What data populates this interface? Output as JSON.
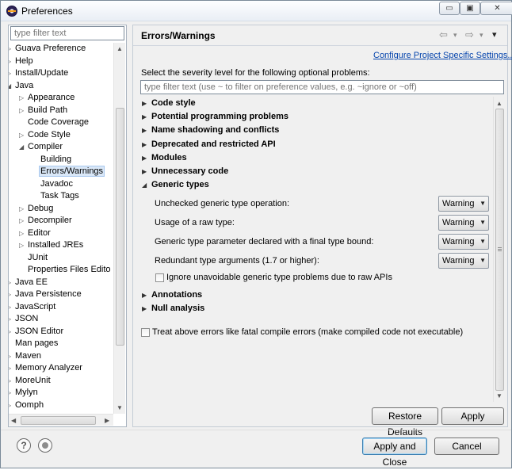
{
  "window": {
    "title": "Preferences",
    "minimize": "▭",
    "maximize": "▣",
    "close": "✕"
  },
  "left": {
    "filter_placeholder": "type filter text",
    "tree": [
      {
        "label": "Guava Preference",
        "level": 0,
        "twisty": "closed"
      },
      {
        "label": "Help",
        "level": 0,
        "twisty": "closed"
      },
      {
        "label": "Install/Update",
        "level": 0,
        "twisty": "closed"
      },
      {
        "label": "Java",
        "level": 0,
        "twisty": "open"
      },
      {
        "label": "Appearance",
        "level": 1,
        "twisty": "closed"
      },
      {
        "label": "Build Path",
        "level": 1,
        "twisty": "closed"
      },
      {
        "label": "Code Coverage",
        "level": 1,
        "twisty": "none"
      },
      {
        "label": "Code Style",
        "level": 1,
        "twisty": "closed"
      },
      {
        "label": "Compiler",
        "level": 1,
        "twisty": "open"
      },
      {
        "label": "Building",
        "level": 2,
        "twisty": "none"
      },
      {
        "label": "Errors/Warnings",
        "level": 2,
        "twisty": "none",
        "selected": true
      },
      {
        "label": "Javadoc",
        "level": 2,
        "twisty": "none"
      },
      {
        "label": "Task Tags",
        "level": 2,
        "twisty": "none"
      },
      {
        "label": "Debug",
        "level": 1,
        "twisty": "closed"
      },
      {
        "label": "Decompiler",
        "level": 1,
        "twisty": "closed"
      },
      {
        "label": "Editor",
        "level": 1,
        "twisty": "closed"
      },
      {
        "label": "Installed JREs",
        "level": 1,
        "twisty": "closed"
      },
      {
        "label": "JUnit",
        "level": 1,
        "twisty": "none"
      },
      {
        "label": "Properties Files Edito",
        "level": 1,
        "twisty": "none"
      },
      {
        "label": "Java EE",
        "level": 0,
        "twisty": "closed"
      },
      {
        "label": "Java Persistence",
        "level": 0,
        "twisty": "closed"
      },
      {
        "label": "JavaScript",
        "level": 0,
        "twisty": "closed"
      },
      {
        "label": "JSON",
        "level": 0,
        "twisty": "closed"
      },
      {
        "label": "JSON Editor",
        "level": 0,
        "twisty": "closed"
      },
      {
        "label": "Man pages",
        "level": 0,
        "twisty": "none"
      },
      {
        "label": "Maven",
        "level": 0,
        "twisty": "closed"
      },
      {
        "label": "Memory Analyzer",
        "level": 0,
        "twisty": "closed"
      },
      {
        "label": "MoreUnit",
        "level": 0,
        "twisty": "closed"
      },
      {
        "label": "Mylyn",
        "level": 0,
        "twisty": "closed"
      },
      {
        "label": "Oomph",
        "level": 0,
        "twisty": "closed"
      }
    ]
  },
  "right": {
    "title": "Errors/Warnings",
    "nav_back": "⇦",
    "nav_forward": "⇨",
    "nav_menu": "▾",
    "config_link": "Configure Project Specific Settings...",
    "description": "Select the severity level for the following optional problems:",
    "filter_placeholder": "type filter text (use ~ to filter on preference values, e.g. ~ignore or ~off)",
    "sections": [
      {
        "label": "Code style",
        "expanded": false
      },
      {
        "label": "Potential programming problems",
        "expanded": false
      },
      {
        "label": "Name shadowing and conflicts",
        "expanded": false
      },
      {
        "label": "Deprecated and restricted API",
        "expanded": false
      },
      {
        "label": "Modules",
        "expanded": false
      },
      {
        "label": "Unnecessary code",
        "expanded": false
      },
      {
        "label": "Generic types",
        "expanded": true
      },
      {
        "label": "Annotations",
        "expanded": false
      },
      {
        "label": "Null analysis",
        "expanded": false
      }
    ],
    "generic_options": [
      {
        "label": "Unchecked generic type operation:",
        "value": "Warning"
      },
      {
        "label": "Usage of a raw type:",
        "value": "Warning"
      },
      {
        "label": "Generic type parameter declared with a final type bound:",
        "value": "Warning"
      },
      {
        "label": "Redundant type arguments (1.7 or higher):",
        "value": "Warning"
      }
    ],
    "ignore_checkbox": "Ignore unavoidable generic type problems due to raw APIs",
    "fatal_checkbox": "Treat above errors like fatal compile errors (make compiled code not executable)",
    "restore_defaults": "Restore Defaults",
    "apply": "Apply"
  },
  "footer": {
    "help_icon": "?",
    "apply_close": "Apply and Close",
    "cancel": "Cancel"
  }
}
